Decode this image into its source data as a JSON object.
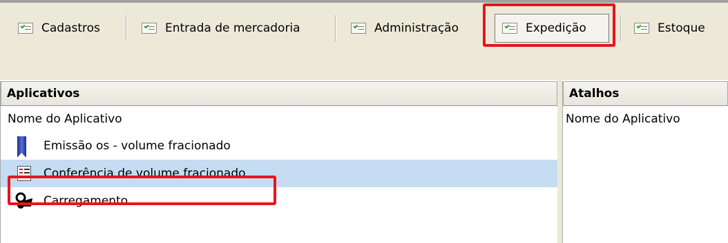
{
  "toolbar": {
    "tabs": [
      {
        "label": "Cadastros"
      },
      {
        "label": "Entrada de mercadoria"
      },
      {
        "label": "Administração"
      },
      {
        "label": "Expedição"
      },
      {
        "label": "Estoque"
      }
    ]
  },
  "aplicativos": {
    "title": "Aplicativos",
    "column_header": "Nome do Aplicativo",
    "items": [
      {
        "label": "Emissão os - volume fracionado",
        "icon": "bookmark-icon"
      },
      {
        "label": "Conferência de volume fracionado",
        "icon": "checklist-icon"
      },
      {
        "label": "Carregamento",
        "icon": "truck-icon"
      }
    ]
  },
  "atalhos": {
    "title": "Atalhos",
    "column_header": "Nome do Aplicativo"
  },
  "colors": {
    "highlight_box": "#e8141c",
    "selected_row": "#c5dcf2",
    "toolbar_bg": "#ece9d8"
  }
}
